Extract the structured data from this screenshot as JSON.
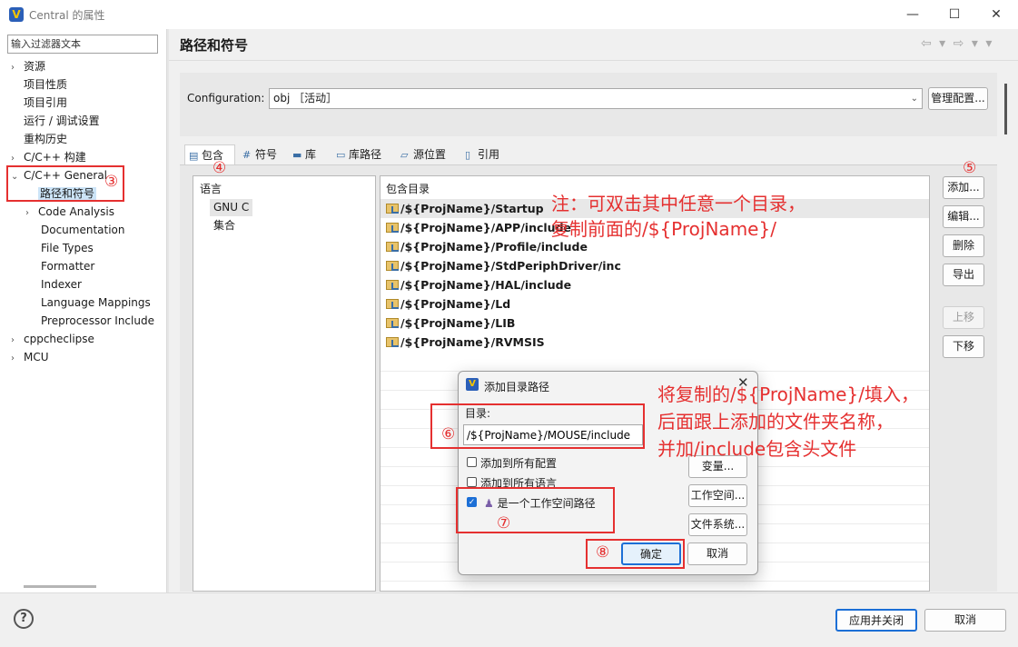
{
  "window": {
    "title": "Central 的属性",
    "minimize": "—",
    "maximize": "☐",
    "close": "✕"
  },
  "sidebar": {
    "filter_placeholder": "输入过滤器文本",
    "items": [
      {
        "label": "资源",
        "arrow": "›"
      },
      {
        "label": "项目性质"
      },
      {
        "label": "项目引用"
      },
      {
        "label": "运行 / 调试设置"
      },
      {
        "label": "重构历史"
      },
      {
        "label": "C/C++ 构建",
        "arrow": "›"
      },
      {
        "label": "C/C++ General",
        "arrow": "⌄"
      },
      {
        "label": "路径和符号"
      },
      {
        "label": "Code Analysis",
        "arrow": "›"
      },
      {
        "label": "Documentation"
      },
      {
        "label": "File Types"
      },
      {
        "label": "Formatter"
      },
      {
        "label": "Indexer"
      },
      {
        "label": "Language Mappings"
      },
      {
        "label": "Preprocessor Include"
      },
      {
        "label": "cppcheclipse",
        "arrow": "›"
      },
      {
        "label": "MCU",
        "arrow": "›"
      }
    ]
  },
  "main": {
    "title": "路径和符号",
    "nav": "⇦ ▾ ⇨ ▾ ▾",
    "configuration_label": "Configuration:",
    "configuration_value": "obj ［活动］",
    "manage_config": "管理配置...",
    "tabs": [
      {
        "label": "包含",
        "icon": "include-icon"
      },
      {
        "label": "符号",
        "icon": "#"
      },
      {
        "label": "库",
        "icon": "library-icon"
      },
      {
        "label": "库路径",
        "icon": "library-path-icon"
      },
      {
        "label": "源位置",
        "icon": "source-location-icon"
      },
      {
        "label": "引用",
        "icon": "reference-icon"
      }
    ],
    "language_header": "语言",
    "languages": [
      "GNU C",
      "集合"
    ],
    "include_header": "包含目录",
    "include_dirs": [
      "/${ProjName}/Startup",
      "/${ProjName}/APP/include",
      "/${ProjName}/Profile/include",
      "/${ProjName}/StdPeriphDriver/inc",
      "/${ProjName}/HAL/include",
      "/${ProjName}/Ld",
      "/${ProjName}/LIB",
      "/${ProjName}/RVMSIS"
    ],
    "side_buttons": {
      "add": "添加...",
      "edit": "编辑...",
      "delete": "删除",
      "export": "导出",
      "up": "上移",
      "down": "下移"
    }
  },
  "dialog": {
    "title": "添加目录路径",
    "dir_label": "目录:",
    "dir_value": "/${ProjName}/MOUSE/include",
    "add_all_configs": "添加到所有配置",
    "add_all_langs": "添加到所有语言",
    "is_workspace_path": "是一个工作空间路径",
    "variables": "变量...",
    "workspace": "工作空间...",
    "filesystem": "文件系统...",
    "ok": "确定",
    "cancel": "取消",
    "is_workspace_checked": true
  },
  "annotations": {
    "n3": "③",
    "n4": "④",
    "n5": "⑤",
    "n6": "⑥",
    "n7": "⑦",
    "n8": "⑧",
    "note1_line1": "注：可双击其中任意一个目录，",
    "note1_line2": "复制前面的/${ProjName}/",
    "note2_line1": "将复制的/${ProjName}/填入，",
    "note2_line2": "后面跟上添加的文件夹名称，",
    "note2_line3": "并加/include包含头文件",
    "color": "#e53030"
  },
  "footer": {
    "help": "?",
    "apply_close": "应用并关闭",
    "cancel": "取消"
  }
}
